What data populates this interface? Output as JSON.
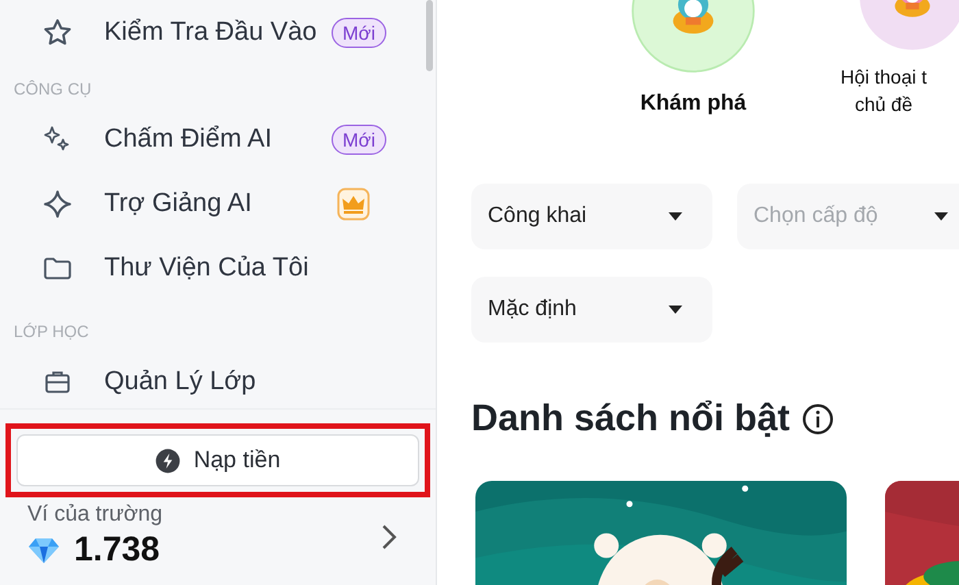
{
  "sidebar": {
    "groups": [
      {
        "items": [
          {
            "label": "Kiểm Tra Đầu Vào",
            "badge": {
              "kind": "new",
              "text": "Mới"
            }
          }
        ]
      },
      {
        "title": "CÔNG CỤ",
        "items": [
          {
            "label": "Chấm Điểm AI",
            "badge": {
              "kind": "new",
              "text": "Mới"
            }
          },
          {
            "label": "Trợ Giảng AI",
            "badge": {
              "kind": "crown"
            }
          },
          {
            "label": "Thư Viện Của Tôi"
          }
        ]
      },
      {
        "title": "LỚP HỌC",
        "items": [
          {
            "label": "Quản Lý Lớp"
          }
        ]
      }
    ],
    "topup_button": {
      "label": "Nạp tiền",
      "highlighted": true
    },
    "wallet": {
      "label": "Ví của trường",
      "amount": "1.738"
    }
  },
  "categories": [
    {
      "label": "Khám phá"
    },
    {
      "label": "Hội thoại t\nchủ đề"
    }
  ],
  "filters": [
    {
      "value": "Công khai"
    },
    {
      "placeholder": "Chọn cấp độ"
    },
    {
      "value": "Mặc định"
    }
  ],
  "featured": {
    "title": "Danh sách nổi bật"
  }
}
